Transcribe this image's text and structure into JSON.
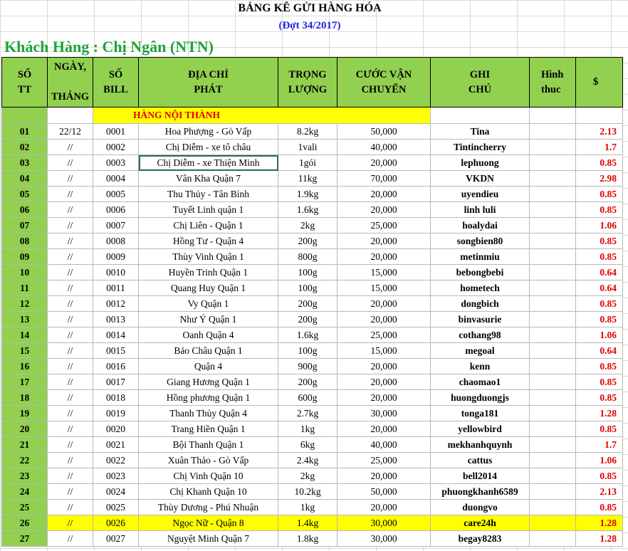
{
  "title": "BẢNG KÊ GỬI HÀNG HÓA",
  "subtitle": "(Đợt 34/2017)",
  "customer": "Khách Hàng : Chị Ngân (NTN)",
  "headers": {
    "stt": [
      "SỐ",
      "TT"
    ],
    "date": [
      "NGÀY,",
      "THÁNG"
    ],
    "bill": [
      "SỐ",
      "BILL"
    ],
    "address": [
      "ĐỊA CHỈ",
      "PHÁT"
    ],
    "weight": [
      "TRỌNG",
      "LƯỢNG"
    ],
    "fee": [
      "CƯỚC VẬN",
      "CHUYỂN"
    ],
    "note": [
      "GHI",
      "CHÚ"
    ],
    "method": [
      "Hình",
      "thuc"
    ],
    "dollar": "$"
  },
  "section_label": "HÀNG NỘI THÀNH",
  "rows": [
    {
      "stt": "01",
      "date": "22/12",
      "bill": "0001",
      "address": "Hoa Phượng - Gò Vấp",
      "weight": "8.2kg",
      "fee": "50,000",
      "note": "Tina",
      "dollar": "2.13"
    },
    {
      "stt": "02",
      "date": "//",
      "bill": "0002",
      "address": "Chị Diễm - xe tô châu",
      "weight": "1vali",
      "fee": "40,000",
      "note": "Tintincherry",
      "dollar": "1.7"
    },
    {
      "stt": "03",
      "date": "//",
      "bill": "0003",
      "address": "Chị Diễm - xe Thiện Minh",
      "weight": "1gói",
      "fee": "20,000",
      "note": "lephuong",
      "dollar": "0.85"
    },
    {
      "stt": "04",
      "date": "//",
      "bill": "0004",
      "address": "Vân Kha Quận 7",
      "weight": "11kg",
      "fee": "70,000",
      "note": "VKDN",
      "dollar": "2.98"
    },
    {
      "stt": "05",
      "date": "//",
      "bill": "0005",
      "address": "Thu Thủy - Tân Bình",
      "weight": "1.9kg",
      "fee": "20,000",
      "note": "uyendieu",
      "dollar": "0.85"
    },
    {
      "stt": "06",
      "date": "//",
      "bill": "0006",
      "address": "Tuyết Linh quận 1",
      "weight": "1.6kg",
      "fee": "20,000",
      "note": "linh luli",
      "dollar": "0.85"
    },
    {
      "stt": "07",
      "date": "//",
      "bill": "0007",
      "address": "Chị Liên - Quận 1",
      "weight": "2kg",
      "fee": "25,000",
      "note": "hoalydai",
      "dollar": "1.06"
    },
    {
      "stt": "08",
      "date": "//",
      "bill": "0008",
      "address": "Hồng Tư - Quận 4",
      "weight": "200g",
      "fee": "20,000",
      "note": "songbien80",
      "dollar": "0.85"
    },
    {
      "stt": "09",
      "date": "//",
      "bill": "0009",
      "address": "Thùy Vinh Quận 1",
      "weight": "800g",
      "fee": "20,000",
      "note": "metinmiu",
      "dollar": "0.85"
    },
    {
      "stt": "10",
      "date": "//",
      "bill": "0010",
      "address": "Huyền Trinh Quận 1",
      "weight": "100g",
      "fee": "15,000",
      "note": "bebongbebi",
      "dollar": "0.64"
    },
    {
      "stt": "11",
      "date": "//",
      "bill": "0011",
      "address": "Quang Huy Quận 1",
      "weight": "100g",
      "fee": "15,000",
      "note": "hometech",
      "dollar": "0.64"
    },
    {
      "stt": "12",
      "date": "//",
      "bill": "0012",
      "address": "Vy Quận 1",
      "weight": "200g",
      "fee": "20,000",
      "note": "dongbich",
      "dollar": "0.85"
    },
    {
      "stt": "13",
      "date": "//",
      "bill": "0013",
      "address": "Như Ý Quận 1",
      "weight": "200g",
      "fee": "20,000",
      "note": "binvasurie",
      "dollar": "0.85"
    },
    {
      "stt": "14",
      "date": "//",
      "bill": "0014",
      "address": "Oanh Quận 4",
      "weight": "1.6kg",
      "fee": "25,000",
      "note": "cothang98",
      "dollar": "1.06"
    },
    {
      "stt": "15",
      "date": "//",
      "bill": "0015",
      "address": "Bảo Châu Quận 1",
      "weight": "100g",
      "fee": "15,000",
      "note": "megoal",
      "dollar": "0.64"
    },
    {
      "stt": "16",
      "date": "//",
      "bill": "0016",
      "address": "Quận 4",
      "weight": "900g",
      "fee": "20,000",
      "note": "kenn",
      "dollar": "0.85"
    },
    {
      "stt": "17",
      "date": "//",
      "bill": "0017",
      "address": "Giang Hương Quận 1",
      "weight": "200g",
      "fee": "20,000",
      "note": "chaomao1",
      "dollar": "0.85"
    },
    {
      "stt": "18",
      "date": "//",
      "bill": "0018",
      "address": "Hồng phương Quận 1",
      "weight": "600g",
      "fee": "20,000",
      "note": "huongduongjs",
      "dollar": "0.85"
    },
    {
      "stt": "19",
      "date": "//",
      "bill": "0019",
      "address": "Thanh Thủy Quận 4",
      "weight": "2.7kg",
      "fee": "30,000",
      "note": "tonga181",
      "dollar": "1.28"
    },
    {
      "stt": "20",
      "date": "//",
      "bill": "0020",
      "address": "Trang Hiền Quận 1",
      "weight": "1kg",
      "fee": "20,000",
      "note": "yellowbird",
      "dollar": "0.85"
    },
    {
      "stt": "21",
      "date": "//",
      "bill": "0021",
      "address": "Bội Thanh Quận 1",
      "weight": "6kg",
      "fee": "40,000",
      "note": "mekhanhquynh",
      "dollar": "1.7"
    },
    {
      "stt": "22",
      "date": "//",
      "bill": "0022",
      "address": "Xuân Thảo - Gò Vấp",
      "weight": "2.4kg",
      "fee": "25,000",
      "note": "cattus",
      "dollar": "1.06"
    },
    {
      "stt": "23",
      "date": "//",
      "bill": "0023",
      "address": "Chị Vinh Quận 10",
      "weight": "2kg",
      "fee": "20,000",
      "note": "bell2014",
      "dollar": "0.85"
    },
    {
      "stt": "24",
      "date": "//",
      "bill": "0024",
      "address": "Chị Khanh Quận 10",
      "weight": "10.2kg",
      "fee": "50,000",
      "note": "phuongkhanh6589",
      "dollar": "2.13"
    },
    {
      "stt": "25",
      "date": "//",
      "bill": "0025",
      "address": "Thùy Dương - Phú Nhuận",
      "weight": "1kg",
      "fee": "20,000",
      "note": "duongvo",
      "dollar": "0.85"
    },
    {
      "stt": "26",
      "date": "//",
      "bill": "0026",
      "address": "Ngọc Nữ - Quận 8",
      "weight": "1.4kg",
      "fee": "30,000",
      "note": "care24h",
      "dollar": "1.28"
    },
    {
      "stt": "27",
      "date": "//",
      "bill": "0027",
      "address": "Nguyệt Minh Quận 7",
      "weight": "1.8kg",
      "fee": "30,000",
      "note": "begay8283",
      "dollar": "1.28"
    }
  ],
  "highlight_row": 25,
  "selected_row": 2,
  "colors": {
    "green": "#92d050",
    "yellow": "#ffff00",
    "red": "#e00000",
    "title_blue": "#1f1fe0",
    "customer_green": "#1fa33b"
  }
}
